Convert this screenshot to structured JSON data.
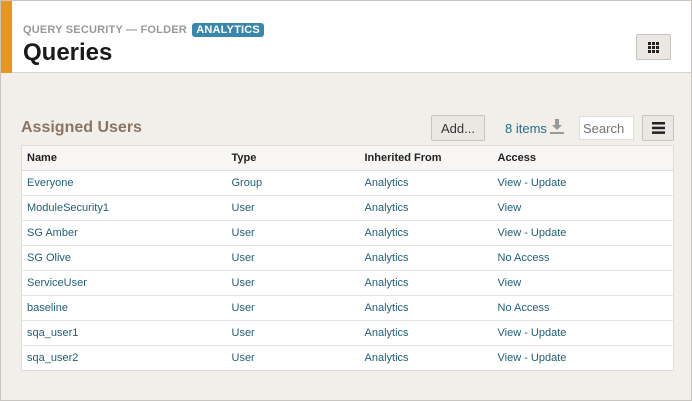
{
  "header": {
    "breadcrumb": "QUERY SECURITY — FOLDER",
    "folder_badge": "ANALYTICS",
    "title": "Queries"
  },
  "section": {
    "title": "Assigned Users",
    "add_label": "Add...",
    "item_count": "8 items",
    "search_placeholder": "Search"
  },
  "table": {
    "columns": [
      "Name",
      "Type",
      "Inherited From",
      "Access"
    ],
    "rows": [
      [
        "Everyone",
        "Group",
        "Analytics",
        "View - Update"
      ],
      [
        "ModuleSecurity1",
        "User",
        "Analytics",
        "View"
      ],
      [
        "SG Amber",
        "User",
        "Analytics",
        "View - Update"
      ],
      [
        "SG Olive",
        "User",
        "Analytics",
        "No Access"
      ],
      [
        "ServiceUser",
        "User",
        "Analytics",
        "View"
      ],
      [
        "baseline",
        "User",
        "Analytics",
        "No Access"
      ],
      [
        "sqa_user1",
        "User",
        "Analytics",
        "View - Update"
      ],
      [
        "sqa_user2",
        "User",
        "Analytics",
        "View - Update"
      ]
    ]
  }
}
